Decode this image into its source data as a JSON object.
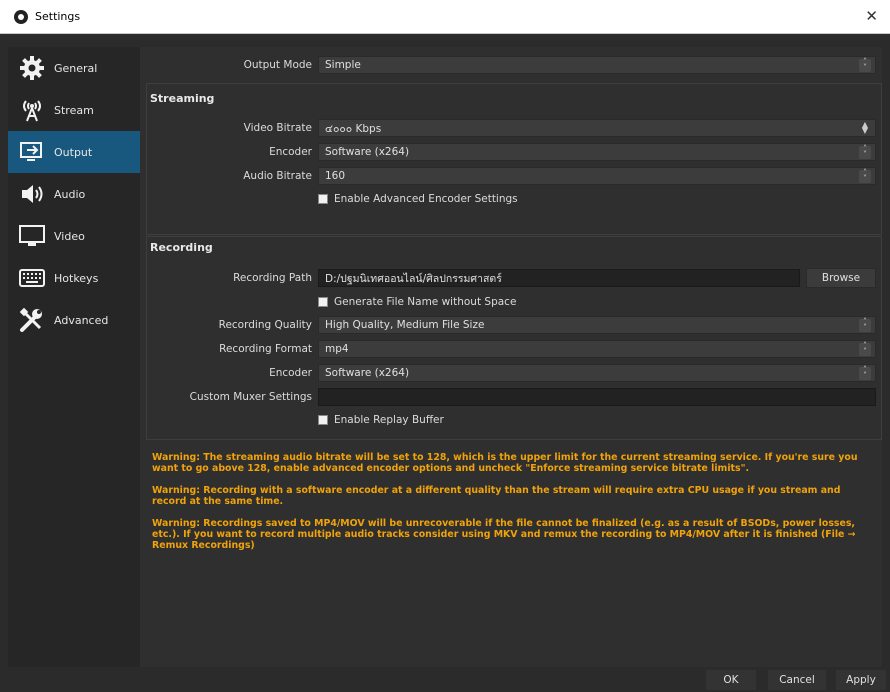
{
  "window": {
    "title": "Settings",
    "close_glyph": "✕"
  },
  "sidebar": {
    "items": [
      {
        "label": "General",
        "icon": "gear-icon"
      },
      {
        "label": "Stream",
        "icon": "antenna-icon"
      },
      {
        "label": "Output",
        "icon": "output-icon",
        "active": true
      },
      {
        "label": "Audio",
        "icon": "speaker-icon"
      },
      {
        "label": "Video",
        "icon": "monitor-icon"
      },
      {
        "label": "Hotkeys",
        "icon": "keyboard-icon"
      },
      {
        "label": "Advanced",
        "icon": "tools-icon"
      }
    ]
  },
  "output_mode": {
    "label": "Output Mode",
    "value": "Simple"
  },
  "streaming": {
    "title": "Streaming",
    "video_bitrate_label": "Video Bitrate",
    "video_bitrate_value": "๔๐๐๐ Kbps",
    "encoder_label": "Encoder",
    "encoder_value": "Software (x264)",
    "audio_bitrate_label": "Audio Bitrate",
    "audio_bitrate_value": "160",
    "advanced_checkbox": "Enable Advanced Encoder Settings"
  },
  "recording": {
    "title": "Recording",
    "path_label": "Recording Path",
    "path_value": "D:/ปฐมนิเทศออนไลน์/ศิลปกรรมศาสตร์",
    "browse_label": "Browse",
    "no_space_checkbox": "Generate File Name without Space",
    "quality_label": "Recording Quality",
    "quality_value": "High Quality, Medium File Size",
    "format_label": "Recording Format",
    "format_value": "mp4",
    "encoder_label": "Encoder",
    "encoder_value": "Software (x264)",
    "muxer_label": "Custom Muxer Settings",
    "muxer_value": "",
    "replay_checkbox": "Enable Replay Buffer"
  },
  "warnings": [
    "Warning: The streaming audio bitrate will be set to 128, which is the upper limit for the current streaming service. If you're sure you want to go above 128, enable advanced encoder options and uncheck \"Enforce streaming service bitrate limits\".",
    "Warning: Recording with a software encoder at a different quality than the stream will require extra CPU usage if you stream and record at the same time.",
    "Warning: Recordings saved to MP4/MOV will be unrecoverable if the file cannot be finalized (e.g. as a result of BSODs, power losses, etc.). If you want to record multiple audio tracks consider using MKV and remux the recording to MP4/MOV after it is finished (File → Remux Recordings)"
  ],
  "footer": {
    "ok": "OK",
    "cancel": "Cancel",
    "apply": "Apply"
  },
  "colors": {
    "accent": "#19587e",
    "warning": "#f0a30a",
    "background": "#2b2b2b"
  }
}
